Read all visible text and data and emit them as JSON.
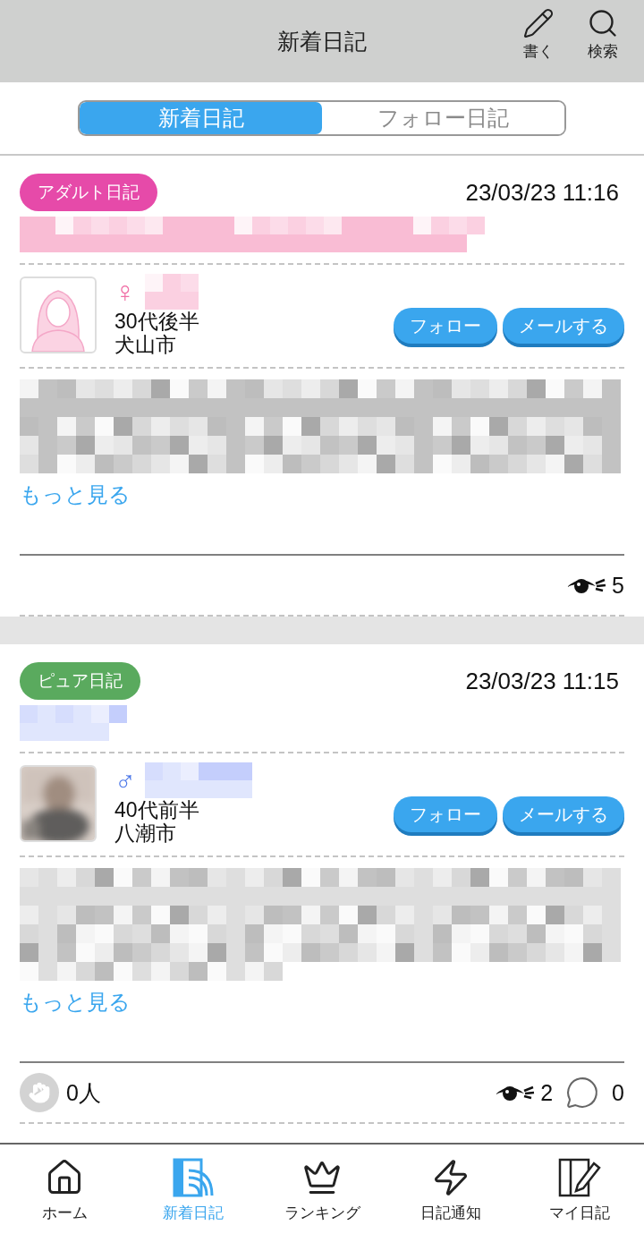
{
  "header": {
    "title": "新着日記",
    "actions": [
      {
        "kind": "write",
        "label": "書く"
      },
      {
        "kind": "search",
        "label": "検索"
      }
    ]
  },
  "tabs": [
    {
      "label": "新着日記",
      "selected": true
    },
    {
      "label": "フォロー日記",
      "selected": false
    }
  ],
  "posts": [
    {
      "category": "アダルト日記",
      "color": "#e64aa9",
      "date": "23/03/23 11:16",
      "title_mosaic": {
        "color": "#f9bcd4"
      },
      "gender": {
        "kind": "female",
        "symbol": "♀"
      },
      "avatar": {
        "kind": "silhouette"
      },
      "age": "30代後半",
      "city": "犬山市",
      "buttons": [
        "フォロー",
        "メールする"
      ],
      "more": "もっと見る",
      "views": "5"
    },
    {
      "category": "ピュア日記",
      "color": "#5aaa5e",
      "date": "23/03/23 11:15",
      "title_mosaic": {
        "color": "#c4cefc"
      },
      "gender": {
        "kind": "male",
        "symbol": "♂"
      },
      "age": "40代前半",
      "city": "八潮市",
      "buttons": [
        "フォロー",
        "メールする"
      ],
      "more": "もっと見る",
      "claps": "0人",
      "views": "2",
      "comments": "0"
    }
  ],
  "nav": [
    {
      "kind": "home",
      "label": "ホーム",
      "selected": false
    },
    {
      "kind": "feed",
      "label": "新着日記",
      "selected": true
    },
    {
      "kind": "ranking",
      "label": "ランキング",
      "selected": false
    },
    {
      "kind": "notice",
      "label": "日記通知",
      "selected": false
    },
    {
      "kind": "mydiary",
      "label": "マイ日記",
      "selected": false
    }
  ]
}
